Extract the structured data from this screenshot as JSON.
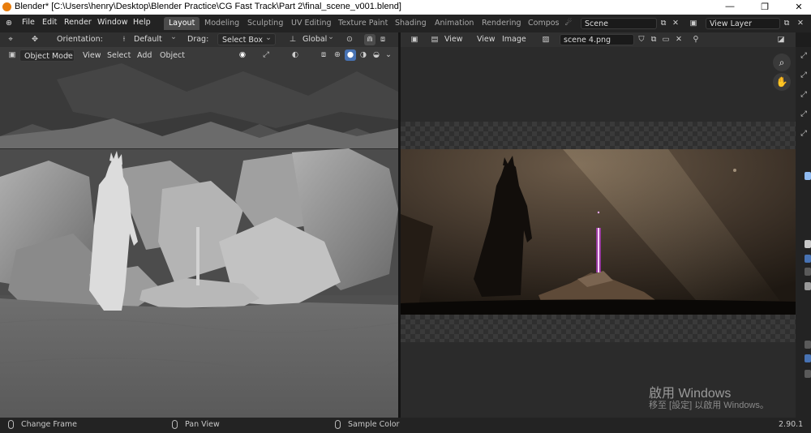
{
  "titlebar": {
    "title": "Blender* [C:\\Users\\henry\\Desktop\\Blender Practice\\CG Fast Track\\Part 2\\final_scene_v001.blend]",
    "minimize": "—",
    "restore": "❐",
    "close": "✕"
  },
  "menubar": {
    "items": [
      "File",
      "Edit",
      "Render",
      "Window",
      "Help"
    ],
    "workspaces": [
      "Layout",
      "Modeling",
      "Sculpting",
      "UV Editing",
      "Texture Paint",
      "Shading",
      "Animation",
      "Rendering",
      "Compos"
    ],
    "active_workspace": "Layout",
    "scene": "Scene",
    "view_layer": "View Layer"
  },
  "toolheader3d": {
    "orientation_label": "Orientation:",
    "orientation_value": "Default",
    "drag_label": "Drag:",
    "drag_value": "Select Box",
    "transform_value": "Global"
  },
  "header3d": {
    "mode": "Object Mode",
    "menus": [
      "View",
      "Select",
      "Add",
      "Object"
    ]
  },
  "imageheader": {
    "view_menu": "View",
    "menus": [
      "View",
      "Image"
    ],
    "image_name": "scene 4.png"
  },
  "watermark": {
    "line1": "啟用 Windows",
    "line2": "移至 [設定] 以啟用 Windows。"
  },
  "statusbar": {
    "left": "Change Frame",
    "middle": "Pan View",
    "right": "Sample Color",
    "version": "2.90.1"
  },
  "colors": {
    "accent": "#4772b3",
    "lightsaber": "#e040ff",
    "blender_orange": "#e87d0d"
  }
}
